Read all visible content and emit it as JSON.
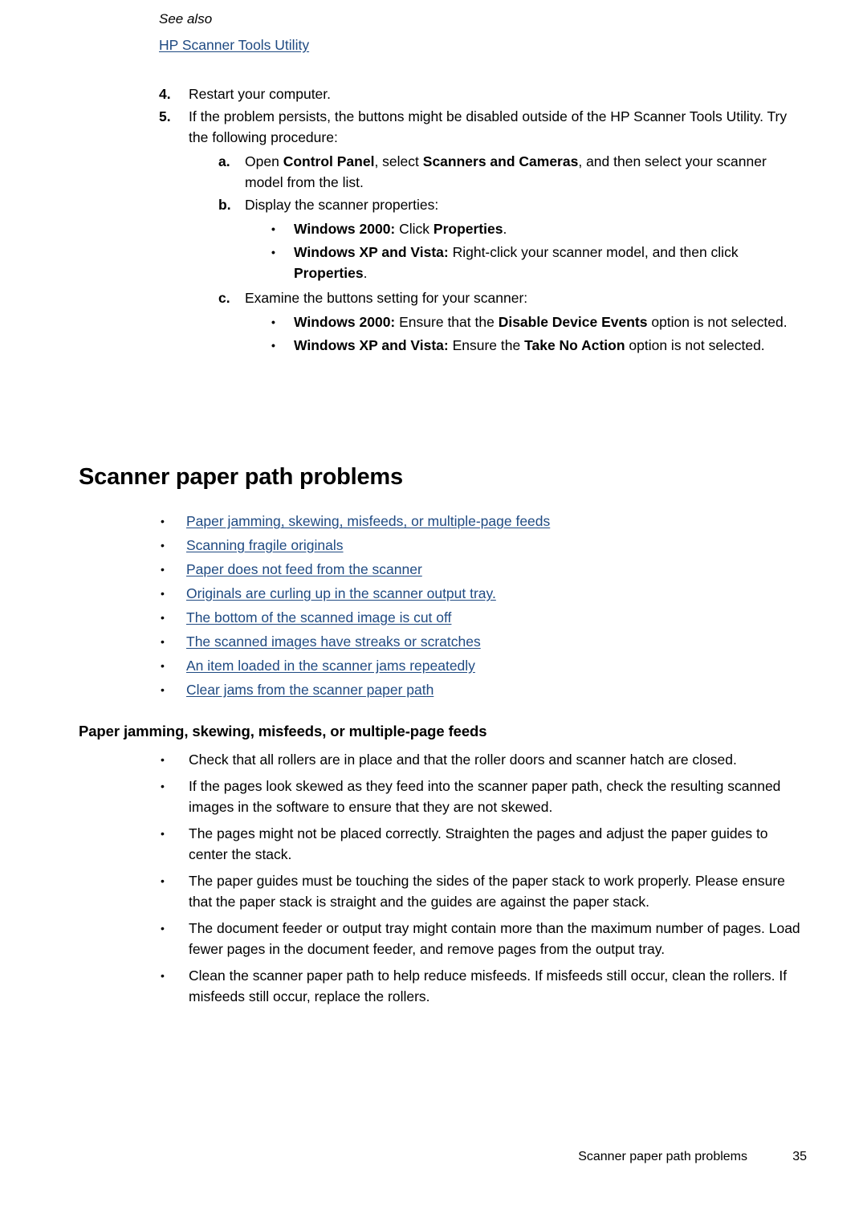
{
  "document": {
    "steps": [
      {
        "number": "4.",
        "text": "Restart your computer."
      },
      {
        "number": "5.",
        "text": "If the problem persists, the buttons might be disabled outside of the HP Scanner Tools Utility. Try the following procedure:",
        "substeps": [
          {
            "letter": "a.",
            "text_parts": [
              {
                "text": "Open ",
                "bold": false
              },
              {
                "text": "Control Panel",
                "bold": true
              },
              {
                "text": ", select ",
                "bold": false
              },
              {
                "text": "Scanners and Cameras",
                "bold": true
              },
              {
                "text": ", and then select your scanner model from the list.",
                "bold": false
              }
            ]
          },
          {
            "letter": "b.",
            "text_parts": [
              {
                "text": "Display the scanner properties:",
                "bold": false
              }
            ],
            "bullets": [
              {
                "parts": [
                  {
                    "text": "Windows 2000:",
                    "bold": true
                  },
                  {
                    "text": " Click ",
                    "bold": false
                  },
                  {
                    "text": "Properties",
                    "bold": true
                  },
                  {
                    "text": ".",
                    "bold": false
                  }
                ]
              },
              {
                "parts": [
                  {
                    "text": "Windows XP and Vista:",
                    "bold": true
                  },
                  {
                    "text": " Right-click your scanner model, and then click ",
                    "bold": false
                  },
                  {
                    "text": "Properties",
                    "bold": true
                  },
                  {
                    "text": ".",
                    "bold": false
                  }
                ]
              }
            ]
          },
          {
            "letter": "c.",
            "text_parts": [
              {
                "text": "Examine the buttons setting for your scanner:",
                "bold": false
              }
            ],
            "bullets": [
              {
                "parts": [
                  {
                    "text": "Windows 2000:",
                    "bold": true
                  },
                  {
                    "text": " Ensure that the ",
                    "bold": false
                  },
                  {
                    "text": "Disable Device Events",
                    "bold": true
                  },
                  {
                    "text": " option is not selected.",
                    "bold": false
                  }
                ]
              },
              {
                "parts": [
                  {
                    "text": "Windows XP and Vista:",
                    "bold": true
                  },
                  {
                    "text": " Ensure the ",
                    "bold": false
                  },
                  {
                    "text": "Take No Action",
                    "bold": true
                  },
                  {
                    "text": " option is not selected.",
                    "bold": false
                  }
                ]
              }
            ]
          }
        ]
      }
    ],
    "see_also_label": "See also",
    "see_also_links": [
      "HP Scanner Tools Utility"
    ],
    "main_heading": "Scanner paper path problems",
    "toc_links": [
      "Paper jamming, skewing, misfeeds, or multiple-page feeds",
      "Scanning fragile originals",
      "Paper does not feed from the scanner",
      "Originals are curling up in the scanner output tray.",
      "The bottom of the scanned image is cut off",
      "The scanned images have streaks or scratches",
      "An item loaded in the scanner jams repeatedly",
      "Clear jams from the scanner paper path"
    ],
    "sub_heading": "Paper jamming, skewing, misfeeds, or multiple-page feeds",
    "body_bullets": [
      "Check that all rollers are in place and that the roller doors and scanner hatch are closed.",
      "If the pages look skewed as they feed into the scanner paper path, check the resulting scanned images in the software to ensure that they are not skewed.",
      "The pages might not be placed correctly. Straighten the pages and adjust the paper guides to center the stack.",
      "The paper guides must be touching the sides of the paper stack to work properly. Please ensure that the paper stack is straight and the guides are against the paper stack.",
      "The document feeder or output tray might contain more than the maximum number of pages. Load fewer pages in the document feeder, and remove pages from the output tray.",
      "Clean the scanner paper path to help reduce misfeeds. If misfeeds still occur, clean the rollers. If misfeeds still occur, replace the rollers."
    ],
    "footer": {
      "title": "Scanner paper path problems",
      "page_number": "35"
    },
    "bullet_glyph": "•",
    "colors": {
      "link": "#1F4A82",
      "text": "#000000",
      "background": "#FFFFFF"
    }
  }
}
